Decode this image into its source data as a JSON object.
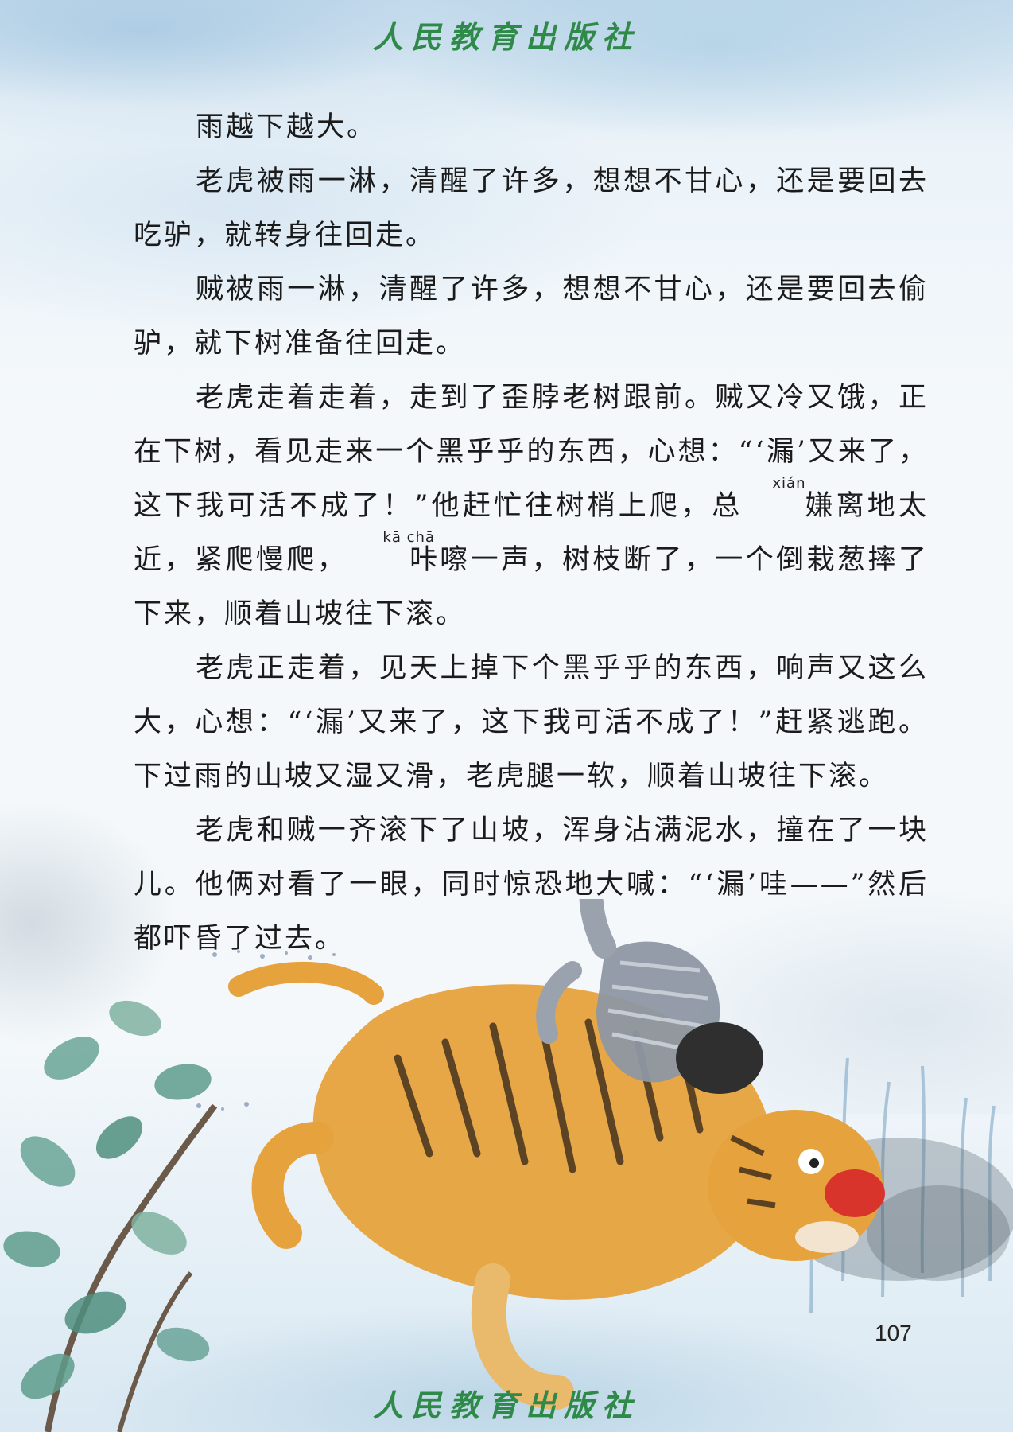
{
  "header": {
    "publisher": "人民教育出版社"
  },
  "footer": {
    "publisher": "人民教育出版社",
    "page_number": "107"
  },
  "paragraphs": {
    "p1": "雨越下越大。",
    "p2": "老虎被雨一淋，清醒了许多，想想不甘心，还是要回去吃驴，就转身往回走。",
    "p3": "贼被雨一淋，清醒了许多，想想不甘心，还是要回去偷驴，就下树准备往回走。",
    "p4": {
      "a": "老虎走着走着，走到了歪脖老树跟前。贼又冷又饿，正在下树，看见走来一个黑乎乎的东西，心想：“‘漏’又来了，这下我可活不成了！”他赶忙往树梢上爬，总",
      "w1": "嫌",
      "w1_pinyin": "xián",
      "b": "离地太近，紧爬慢爬，",
      "w2": "咔嚓",
      "w2_pinyin": "kā chā",
      "c": "一声，树枝断了，一个倒栽葱摔了下来，顺着山坡往下滚。"
    },
    "p5": "老虎正走着，见天上掉下个黑乎乎的东西，响声又这么大，心想：“‘漏’又来了，这下我可活不成了！”赶紧逃跑。下过雨的山坡又湿又滑，老虎腿一软，顺着山坡往下滚。",
    "p6": "老虎和贼一齐滚下了山坡，浑身沾满泥水，撞在了一块儿。他俩对看了一眼，同时惊恐地大喊：“‘漏’哇——”然后都吓昏了过去。"
  },
  "illustration": {
    "subject": "tiger-and-thief-illustration",
    "colors": {
      "tiger": "#e6a23c",
      "stripes": "#3a2a1a",
      "thief_clothes": "#8d97a3",
      "leaves": "#5fa08c",
      "nose": "#d9342b"
    }
  }
}
